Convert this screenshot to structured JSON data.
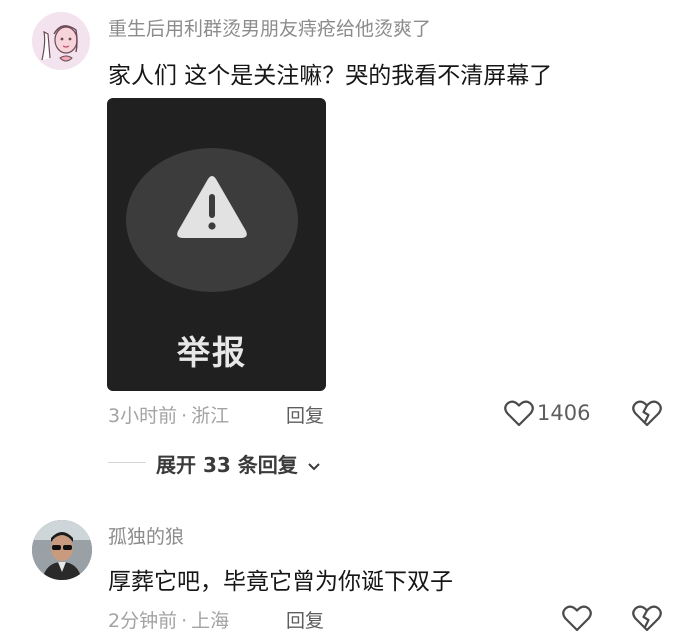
{
  "comments": [
    {
      "username": "重生后用利群烫男朋友痔疮给他烫爽了",
      "text": "家人们 这个是关注嘛？哭的我看不清屏幕了",
      "image_card": {
        "label": "举报",
        "icon": "warning-triangle-icon"
      },
      "time": "3小时前",
      "separator": "·",
      "location": "浙江",
      "reply_label": "回复",
      "likes": "1406",
      "expand_label": "展开 33 条回复"
    },
    {
      "username": "孤独的狼",
      "text": "厚葬它吧，毕竟它曾为你诞下双子",
      "time": "2分钟前",
      "separator": "·",
      "location": "上海",
      "reply_label": "回复"
    }
  ],
  "colors": {
    "card_bg": "#202020",
    "circle_bg": "#3c3c3c",
    "meta_text": "#a3a3a3",
    "username_text": "#8c8c8c"
  }
}
